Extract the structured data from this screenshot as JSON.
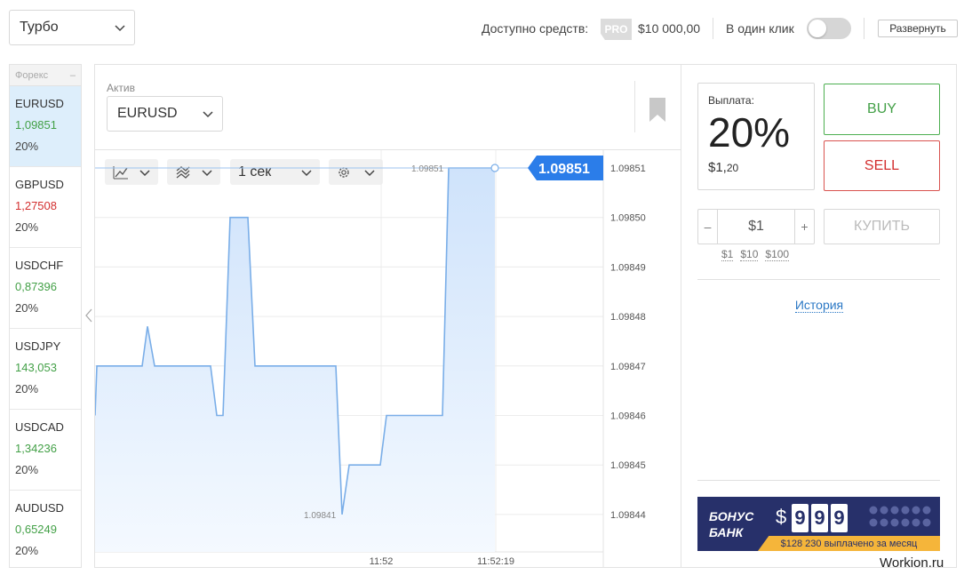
{
  "header": {
    "mode": "Турбо",
    "funds_label": "Доступно средств:",
    "pro_badge": "PRO",
    "funds_value": "$10 000,00",
    "oneclick_label": "В один клик",
    "oneclick_on": false,
    "expand_label": "Развернуть"
  },
  "sidebar": {
    "group": "Форекс",
    "collapse_symbol": "–",
    "items": [
      {
        "name": "EURUSD",
        "price": "1,09851",
        "pct": "20%",
        "dir": "up",
        "active": true
      },
      {
        "name": "GBPUSD",
        "price": "1,27508",
        "pct": "20%",
        "dir": "down",
        "active": false
      },
      {
        "name": "USDCHF",
        "price": "0,87396",
        "pct": "20%",
        "dir": "up",
        "active": false
      },
      {
        "name": "USDJPY",
        "price": "143,053",
        "pct": "20%",
        "dir": "up",
        "active": false
      },
      {
        "name": "USDCAD",
        "price": "1,34236",
        "pct": "20%",
        "dir": "up",
        "active": false
      },
      {
        "name": "AUDUSD",
        "price": "0,65249",
        "pct": "20%",
        "dir": "up",
        "active": false
      }
    ]
  },
  "chart_panel": {
    "asset_label": "Актив",
    "asset_value": "EURUSD",
    "timeframe": "1 сек"
  },
  "chart_data": {
    "type": "area",
    "y_ticks": [
      "1.09851",
      "1.09850",
      "1.09849",
      "1.09848",
      "1.09847",
      "1.09846",
      "1.09845",
      "1.09844"
    ],
    "ylim": [
      1.09844,
      1.09851
    ],
    "x_ticks": [
      "11:52",
      "11:52:19"
    ],
    "current_price": "1.09851",
    "high_label": "1.09851",
    "low_label": "1.09841",
    "points": [
      [
        0,
        1.09846
      ],
      [
        2,
        1.09847
      ],
      [
        53,
        1.09847
      ],
      [
        59,
        1.098478
      ],
      [
        67,
        1.09847
      ],
      [
        130,
        1.09847
      ],
      [
        137,
        1.09846
      ],
      [
        144,
        1.09846
      ],
      [
        152,
        1.0985
      ],
      [
        172,
        1.0985
      ],
      [
        180,
        1.09847
      ],
      [
        271,
        1.09847
      ],
      [
        278,
        1.09844
      ],
      [
        286,
        1.09845
      ],
      [
        321,
        1.09845
      ],
      [
        328,
        1.09846
      ],
      [
        391,
        1.09846
      ],
      [
        398,
        1.09851
      ],
      [
        450,
        1.09851
      ]
    ],
    "colors": {
      "line": "#7aaee8",
      "fill": "#e3effd",
      "badge": "#2b7de9"
    }
  },
  "trade": {
    "payout_label": "Выплата:",
    "payout_pct": "20%",
    "payout_amount_main": "$1,",
    "payout_amount_cents": "20",
    "buy_label": "BUY",
    "sell_label": "SELL",
    "minus": "–",
    "plus": "+",
    "amount": "$1",
    "purchase_label": "КУПИТЬ",
    "quick_amounts": [
      "$1",
      "$10",
      "$100"
    ],
    "history_label": "История"
  },
  "bonus": {
    "title_line1": "БОНУС",
    "title_line2": "БАНК",
    "dollar": "$",
    "digits": [
      "9",
      "9",
      "9"
    ],
    "strip": "$128 230 выплачено за месяц"
  },
  "watermark": "Workion.ru"
}
